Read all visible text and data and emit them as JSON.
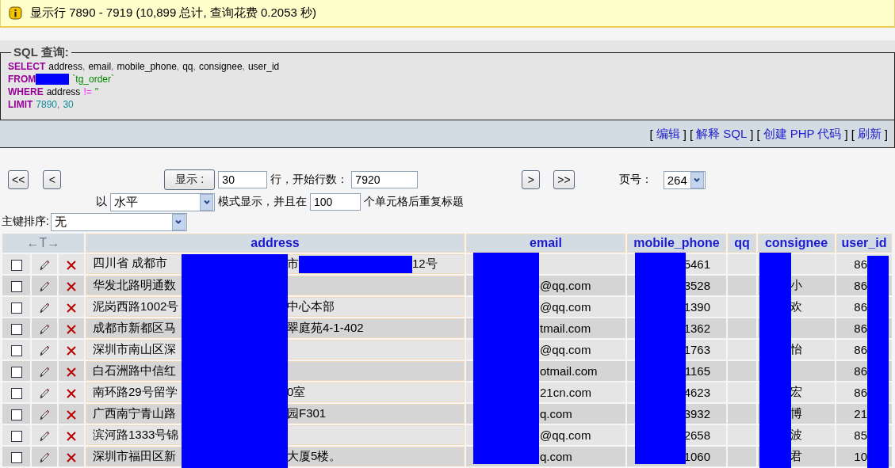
{
  "notice": {
    "text": "显示行  7890 - 7919 (10,899 总计, 查询花费  0.2053 秒)"
  },
  "sql_box": {
    "legend": "SQL 查询:",
    "lines": [
      [
        {
          "kind": "keyword",
          "text": "SELECT"
        },
        {
          "kind": "name",
          "text": "address"
        },
        {
          "kind": "punct",
          "text": ","
        },
        {
          "kind": "name",
          "text": "email"
        },
        {
          "kind": "punct",
          "text": ","
        },
        {
          "kind": "name",
          "text": "mobile_phone"
        },
        {
          "kind": "punct",
          "text": ","
        },
        {
          "kind": "name",
          "text": "qq"
        },
        {
          "kind": "punct",
          "text": ","
        },
        {
          "kind": "name",
          "text": "consignee"
        },
        {
          "kind": "punct",
          "text": ","
        },
        {
          "kind": "name",
          "text": "user_id"
        }
      ],
      [
        {
          "kind": "keyword",
          "text": "FROM"
        },
        {
          "kind": "redacted"
        },
        {
          "kind": "table",
          "text": "`tg_order`"
        }
      ],
      [
        {
          "kind": "keyword",
          "text": "WHERE"
        },
        {
          "kind": "name",
          "text": "address"
        },
        {
          "kind": "operator",
          "text": "!="
        },
        {
          "kind": "string",
          "text": "''"
        }
      ],
      [
        {
          "kind": "keyword",
          "text": "LIMIT"
        },
        {
          "kind": "number",
          "text": "7890"
        },
        {
          "kind": "punct",
          "text": ","
        },
        {
          "kind": "number",
          "text": "30"
        }
      ]
    ],
    "brackets": {
      "open": "[",
      "close": "]"
    },
    "links": [
      "编辑",
      "解释  SQL",
      "创建  PHP 代码",
      "刷新"
    ]
  },
  "navigation": {
    "first_button": "<<",
    "prev_button": "<",
    "show_button": "显示 :",
    "rows_value": "30",
    "rows_label": "行，开始行数：",
    "start_value": "7920",
    "next_button": ">",
    "last_button": ">>",
    "page_label": "页号：",
    "page_value": "264",
    "mode_prefix": "以",
    "mode_value": "水平",
    "mode_label": "模式显示，并且在",
    "repeat_value": "100",
    "repeat_label": "个单元格后重复标题",
    "sort_label": "主键排序:",
    "sort_value": "无"
  },
  "table": {
    "arrows_header": "←T→",
    "columns": [
      "address",
      "email",
      "mobile_phone",
      "qq",
      "consignee",
      "user_id"
    ],
    "rows": [
      {
        "checked": false,
        "address": [
          "四川省  成都市",
          "市",
          "12号"
        ],
        "mobile_phone": "5461",
        "user_id": "86"
      },
      {
        "checked": false,
        "address": [
          "华发北路明通数"
        ],
        "email": "@qq.com",
        "mobile_phone": "3528",
        "consignee": "小",
        "user_id": "86"
      },
      {
        "checked": false,
        "address": [
          "泥岗西路1002号",
          "中心本部"
        ],
        "email": "@qq.com",
        "mobile_phone": "1390",
        "consignee": "欢",
        "user_id": "86"
      },
      {
        "checked": false,
        "address": [
          "成都市新都区马",
          "翠庭苑4-1-402"
        ],
        "email": "tmail.com",
        "mobile_phone": "1362",
        "user_id": "86"
      },
      {
        "checked": false,
        "address": [
          "深圳市南山区深"
        ],
        "email": "@qq.com",
        "mobile_phone": "1763",
        "consignee": "怡",
        "user_id": "86"
      },
      {
        "checked": false,
        "address": [
          "白石洲路中信红"
        ],
        "email": "otmail.com",
        "mobile_phone": "1165",
        "user_id": "86"
      },
      {
        "checked": false,
        "address": [
          "南环路29号留学",
          "0室"
        ],
        "email": "21cn.com",
        "mobile_phone": "4623",
        "consignee": "宏",
        "user_id": "86"
      },
      {
        "checked": false,
        "address": [
          "广西南宁青山路",
          "园F301"
        ],
        "email": "q.com",
        "mobile_phone": "3932",
        "consignee": "博",
        "user_id": "21"
      },
      {
        "checked": false,
        "address": [
          "滨河路1333号锦"
        ],
        "email": "@qq.com",
        "mobile_phone": "2658",
        "consignee": "波",
        "user_id": "85"
      },
      {
        "checked": false,
        "address": [
          "深圳市福田区新",
          "大厦5楼。"
        ],
        "email": "q.com",
        "mobile_phone": "1060",
        "consignee": "君",
        "user_id": "10"
      }
    ]
  }
}
